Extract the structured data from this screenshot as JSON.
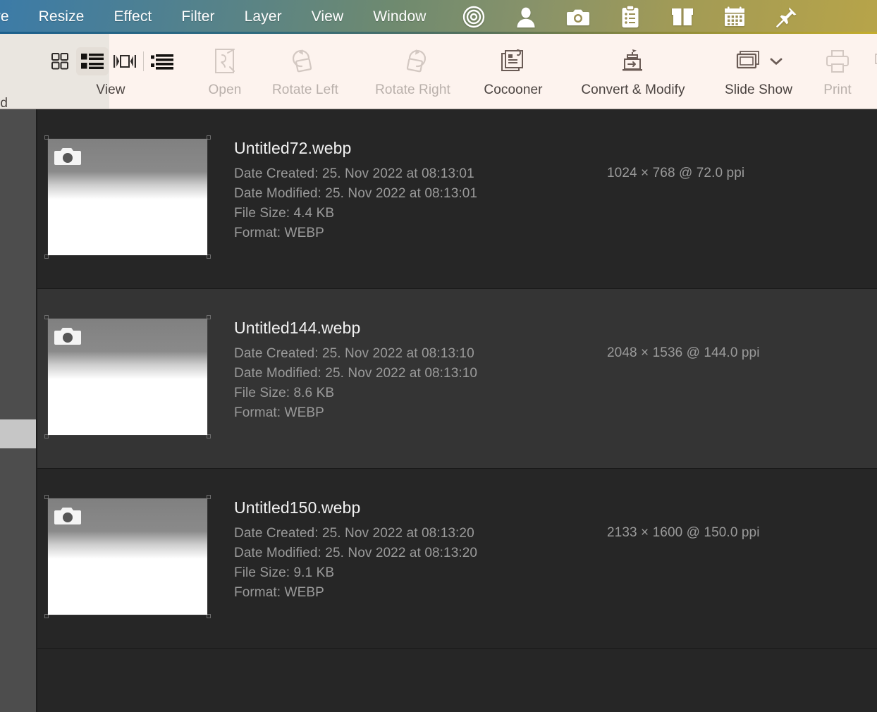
{
  "menubar": {
    "items": [
      {
        "label": "ure",
        "name": "menu-picture",
        "clipped": true
      },
      {
        "label": "Resize",
        "name": "menu-resize",
        "clipped": false
      },
      {
        "label": "Effect",
        "name": "menu-effect",
        "clipped": false
      },
      {
        "label": "Filter",
        "name": "menu-filter",
        "clipped": false
      },
      {
        "label": "Layer",
        "name": "menu-layer",
        "clipped": false
      },
      {
        "label": "View",
        "name": "menu-view",
        "clipped": false
      },
      {
        "label": "Window",
        "name": "menu-window",
        "clipped": false
      }
    ],
    "icons": [
      {
        "name": "target-icon"
      },
      {
        "name": "person-icon"
      },
      {
        "name": "camera-icon"
      },
      {
        "name": "clipboard-icon"
      },
      {
        "name": "box-icon"
      },
      {
        "name": "calendar-icon"
      },
      {
        "name": "pin-icon"
      }
    ],
    "gradient_start": "#3c7ba7",
    "gradient_end": "#b7a449"
  },
  "toolbar": {
    "clipped_left_label": "rd",
    "groups": [
      {
        "name": "view-modes",
        "label": "View",
        "enabled": true,
        "buttons": [
          {
            "name": "view-icons-button",
            "icon": "grid-icon",
            "active": false
          },
          {
            "name": "view-list-button",
            "icon": "list-thumbnail-icon",
            "active": true
          },
          {
            "name": "view-filmstrip-button",
            "icon": "filmstrip-icon",
            "active": false
          },
          {
            "name": "view-details-button",
            "icon": "details-list-icon",
            "active": false
          }
        ]
      },
      {
        "name": "open-button",
        "label": "Open",
        "icon": "open-document-icon",
        "enabled": false
      },
      {
        "name": "rotate-left-button",
        "label": "Rotate Left",
        "icon": "rotate-left-icon",
        "enabled": false
      },
      {
        "name": "rotate-right-button",
        "label": "Rotate Right",
        "icon": "rotate-right-icon",
        "enabled": false
      },
      {
        "name": "cocooner-button",
        "label": "Cocooner",
        "icon": "cocooner-icon",
        "enabled": true
      },
      {
        "name": "convert-modify-button",
        "label": "Convert & Modify",
        "icon": "convert-modify-icon",
        "enabled": true
      },
      {
        "name": "slide-show-button",
        "label": "Slide Show",
        "icon": "slideshow-icon",
        "enabled": true,
        "has_chevron": true
      },
      {
        "name": "print-button",
        "label": "Print",
        "icon": "printer-icon",
        "enabled": false
      }
    ]
  },
  "files": [
    {
      "filename": "Untitled72.webp",
      "date_created": "Date Created: 25. Nov 2022 at 08:13:01",
      "date_modified": "Date Modified: 25. Nov 2022 at 08:13:01",
      "file_size": "File Size: 4.4 KB",
      "format": "Format: WEBP",
      "dimensions": "1024 × 768 @ 72.0 ppi",
      "thumbnail_icon": "camera-placeholder-icon"
    },
    {
      "filename": "Untitled144.webp",
      "date_created": "Date Created: 25. Nov 2022 at 08:13:10",
      "date_modified": "Date Modified: 25. Nov 2022 at 08:13:10",
      "file_size": "File Size: 8.6 KB",
      "format": "Format: WEBP",
      "dimensions": "2048 × 1536 @ 144.0 ppi",
      "thumbnail_icon": "camera-placeholder-icon"
    },
    {
      "filename": "Untitled150.webp",
      "date_created": "Date Created: 25. Nov 2022 at 08:13:20",
      "date_modified": "Date Modified: 25. Nov 2022 at 08:13:20",
      "file_size": "File Size: 9.1 KB",
      "format": "Format: WEBP",
      "dimensions": "2133 × 1600 @ 150.0 ppi",
      "thumbnail_icon": "camera-placeholder-icon"
    }
  ],
  "colors": {
    "content_bg": "#262626",
    "row_alt_bg": "#343434",
    "sidebar_bg": "#4d4d4d",
    "toolbar_bg": "#fdf3ee",
    "filename_text": "#f2f2f2",
    "meta_text": "#9a9a9a"
  }
}
